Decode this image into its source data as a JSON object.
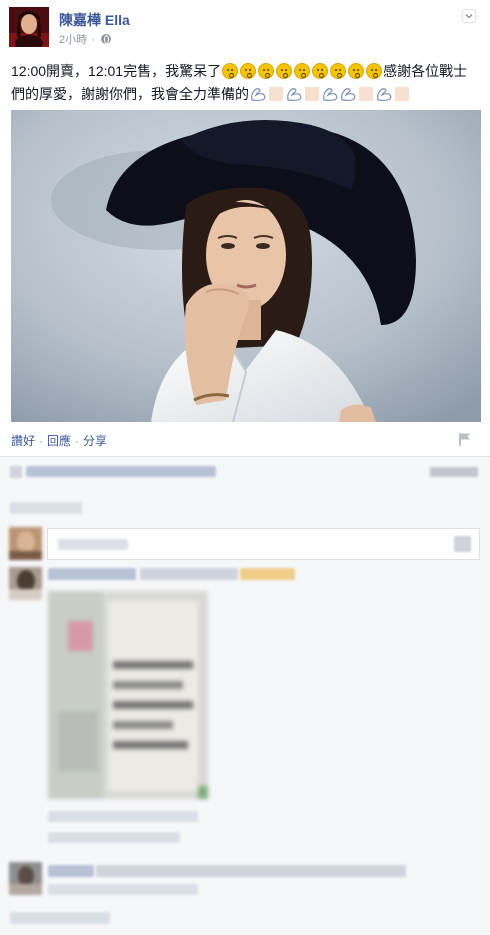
{
  "post": {
    "author": "陳嘉樺 Ella",
    "time": "2小時",
    "meta_separator": "·",
    "text_part1": "12:00開賣，12:01完售，我驚呆了",
    "text_part2": "感謝各位戰士們的厚愛，謝謝你們，我會全力準備的",
    "emoticon_count": 9,
    "actions": {
      "like": "讚好",
      "comment": "回應",
      "share": "分享",
      "separator": "·"
    }
  },
  "icons": {
    "options": "chevron-down-icon",
    "privacy": "globe-icon",
    "report": "flag-icon",
    "emoticon": "astonished-face-icon",
    "muscle": "flexed-biceps-icon",
    "camera": "camera-icon"
  },
  "colors": {
    "link": "#3b5998",
    "meta": "#9197a3",
    "background": "#f6f7f9",
    "card": "#ffffff"
  }
}
